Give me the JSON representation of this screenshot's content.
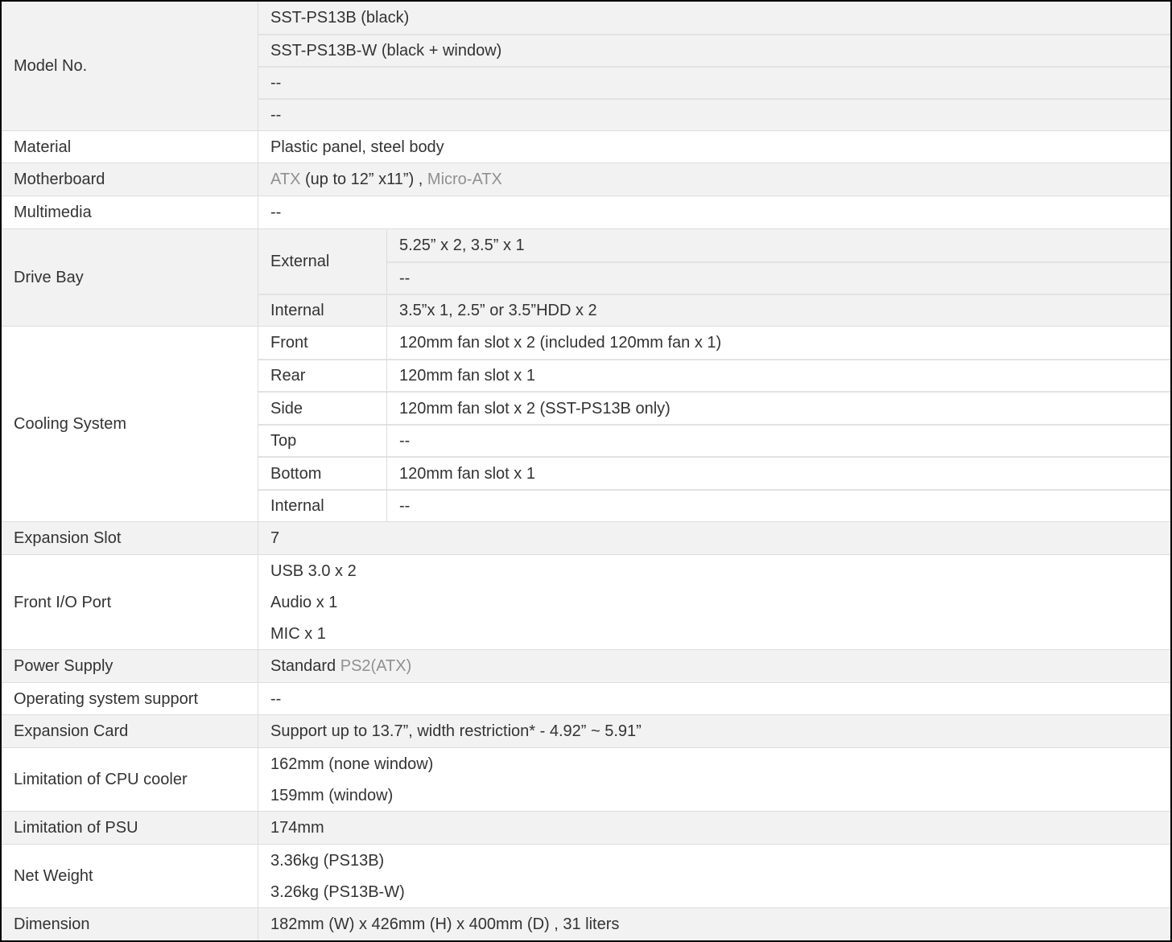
{
  "specs": {
    "model_no": {
      "label": "Model No.",
      "values": [
        "SST-PS13B (black)",
        "SST-PS13B-W (black + window)",
        "--",
        "--"
      ]
    },
    "material": {
      "label": "Material",
      "value": "Plastic panel, steel body"
    },
    "motherboard": {
      "label": "Motherboard",
      "atx": "ATX",
      "atx_note": " (up to 12” x11”) , ",
      "matx": "Micro-ATX"
    },
    "multimedia": {
      "label": "Multimedia",
      "value": "--"
    },
    "drive_bay": {
      "label": "Drive Bay",
      "external_label": "External",
      "external_values": [
        "5.25” x 2, 3.5” x 1",
        "--"
      ],
      "internal_label": "Internal",
      "internal_value": "3.5”x 1, 2.5” or 3.5”HDD x 2"
    },
    "cooling": {
      "label": "Cooling System",
      "rows": [
        {
          "pos": "Front",
          "value": "120mm fan slot x 2 (included 120mm fan x 1)"
        },
        {
          "pos": "Rear",
          "value": "120mm fan slot x 1"
        },
        {
          "pos": "Side",
          "value": "120mm fan slot x 2 (SST-PS13B only)"
        },
        {
          "pos": "Top",
          "value": "--"
        },
        {
          "pos": "Bottom",
          "value": "120mm fan slot x 1"
        },
        {
          "pos": "Internal",
          "value": "--"
        }
      ]
    },
    "expansion_slot": {
      "label": "Expansion Slot",
      "value": "7"
    },
    "front_io": {
      "label": "Front I/O Port",
      "values": [
        "USB 3.0 x 2",
        "Audio x 1",
        "MIC x 1"
      ]
    },
    "power_supply": {
      "label": "Power Supply",
      "prefix": "Standard ",
      "link": "PS2(ATX)"
    },
    "os_support": {
      "label": "Operating system support",
      "value": "--"
    },
    "expansion_card": {
      "label": "Expansion Card",
      "value": "Support up to 13.7”, width restriction* - 4.92” ~ 5.91”"
    },
    "cpu_cooler": {
      "label": "Limitation of CPU cooler",
      "values": [
        "162mm (none window)",
        "159mm (window)"
      ]
    },
    "psu_limit": {
      "label": "Limitation of PSU",
      "value": "174mm"
    },
    "net_weight": {
      "label": "Net Weight",
      "values": [
        "3.36kg (PS13B)",
        "3.26kg (PS13B-W)"
      ]
    },
    "dimension": {
      "label": "Dimension",
      "value": "182mm (W) x 426mm (H) x 400mm (D) , 31 liters"
    }
  }
}
